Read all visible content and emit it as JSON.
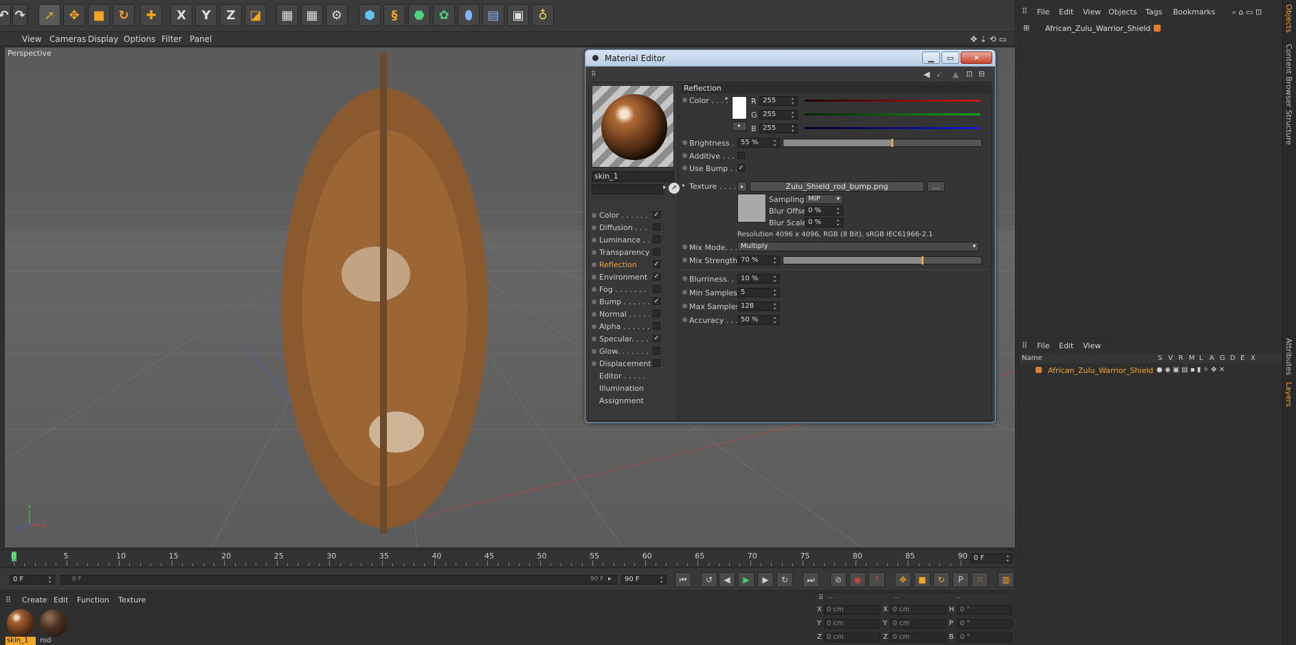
{
  "viewport_menu": [
    "View",
    "Cameras",
    "Display",
    "Options",
    "Filter",
    "Panel"
  ],
  "viewport_label": "Perspective",
  "object_manager": {
    "menu": [
      "File",
      "Edit",
      "View",
      "Objects",
      "Tags",
      "Bookmarks"
    ],
    "object_name": "African_Zulu_Warrior_Shield"
  },
  "layer_manager": {
    "menu": [
      "File",
      "Edit",
      "View"
    ],
    "header_name": "Name",
    "header_cols": [
      "S",
      "V",
      "R",
      "M",
      "L",
      "A",
      "G",
      "D",
      "E",
      "X"
    ],
    "layer_name": "African_Zulu_Warrior_Shield",
    "layer_color": "#f5a623"
  },
  "side_tabs": [
    "Objects",
    "Content Browser",
    "Structure",
    "Attributes",
    "Layers"
  ],
  "material_editor": {
    "title": "Material Editor",
    "material_name": "skin_1",
    "channels": [
      {
        "label": "Color . . . . . .",
        "checked": "✓"
      },
      {
        "label": "Diffusion . . .",
        "checked": ""
      },
      {
        "label": "Luminance . . .",
        "checked": ""
      },
      {
        "label": "Transparency",
        "checked": ""
      },
      {
        "label": "Reflection",
        "checked": "✓",
        "active": true
      },
      {
        "label": "Environment",
        "checked": "✓"
      },
      {
        "label": "Fog . . . . . . .",
        "checked": ""
      },
      {
        "label": "Bump . . . . . .",
        "checked": "✓"
      },
      {
        "label": "Normal . . . . .",
        "checked": ""
      },
      {
        "label": "Alpha . . . . . .",
        "checked": ""
      },
      {
        "label": "Specular. . . .",
        "checked": "✓"
      },
      {
        "label": "Glow. . . . . . .",
        "checked": ""
      },
      {
        "label": "Displacement",
        "checked": ""
      }
    ],
    "extra_items": [
      "Editor . . . . .",
      "Illumination",
      "Assignment"
    ],
    "section": "Reflection",
    "color_label": "Color . . . .",
    "r_label": "R",
    "g_label": "G",
    "b_label": "B",
    "r": "255",
    "g": "255",
    "b": "255",
    "brightness_label": "Brightness . .",
    "brightness": "55 %",
    "brightness_fraction": 0.55,
    "additive_label": "Additive . . . .",
    "additive_checked": "",
    "use_bump_label": "Use Bump . .",
    "use_bump_checked": "✓",
    "texture_label": "Texture . . . .",
    "texture_file": "Zulu_Shield_rod_bump.png",
    "texture_browse": "...",
    "sampling_label": "Sampling",
    "sampling": "MIP",
    "blur_offset_label": "Blur Offset",
    "blur_offset": "0 %",
    "blur_scale_label": "Blur Scale",
    "blur_scale": "0 %",
    "resolution": "Resolution 4096 x 4096, RGB (8 Bit), sRGB IEC61966-2.1",
    "mix_mode_label": "Mix Mode. . .",
    "mix_mode": "Multiply",
    "mix_strength_label": "Mix Strength",
    "mix_strength": "70 %",
    "mix_strength_fraction": 0.7,
    "blurriness_label": "Blurriness. . .",
    "blurriness": "10 %",
    "min_samples_label": "Min Samples",
    "min_samples": "5",
    "max_samples_label": "Max Samples",
    "max_samples": "128",
    "accuracy_label": "Accuracy . . . .",
    "accuracy": "50 %"
  },
  "timeline": {
    "ticks": [
      "0",
      "5",
      "10",
      "15",
      "20",
      "25",
      "30",
      "35",
      "40",
      "45",
      "50",
      "55",
      "60",
      "65",
      "70",
      "75",
      "80",
      "85",
      "90"
    ],
    "current_frame_field": "0 F",
    "start_field": "0 F",
    "range_start": "0 F",
    "range_end": "90 F",
    "end_field": "90 F"
  },
  "material_manager": {
    "menu": [
      "Create",
      "Edit",
      "Function",
      "Texture"
    ],
    "materials": [
      "skin_1",
      "rod"
    ]
  },
  "coordinates": {
    "header": [
      "--",
      "--",
      "--"
    ],
    "rows": [
      {
        "a": "X",
        "av": "0 cm",
        "b": "X",
        "bv": "0 cm",
        "c": "H",
        "cv": "0 °"
      },
      {
        "a": "Y",
        "av": "0 cm",
        "b": "Y",
        "bv": "0 cm",
        "c": "P",
        "cv": "0 °"
      },
      {
        "a": "Z",
        "av": "0 cm",
        "b": "Z",
        "bv": "0 cm",
        "c": "B",
        "cv": "0 °"
      }
    ]
  },
  "axis_labels": {
    "y": "Y",
    "z": "Z",
    "x": "X"
  },
  "colors": {
    "accent": "#f5a623",
    "r": "#d01818",
    "g": "#18a818",
    "b": "#1818d0"
  }
}
